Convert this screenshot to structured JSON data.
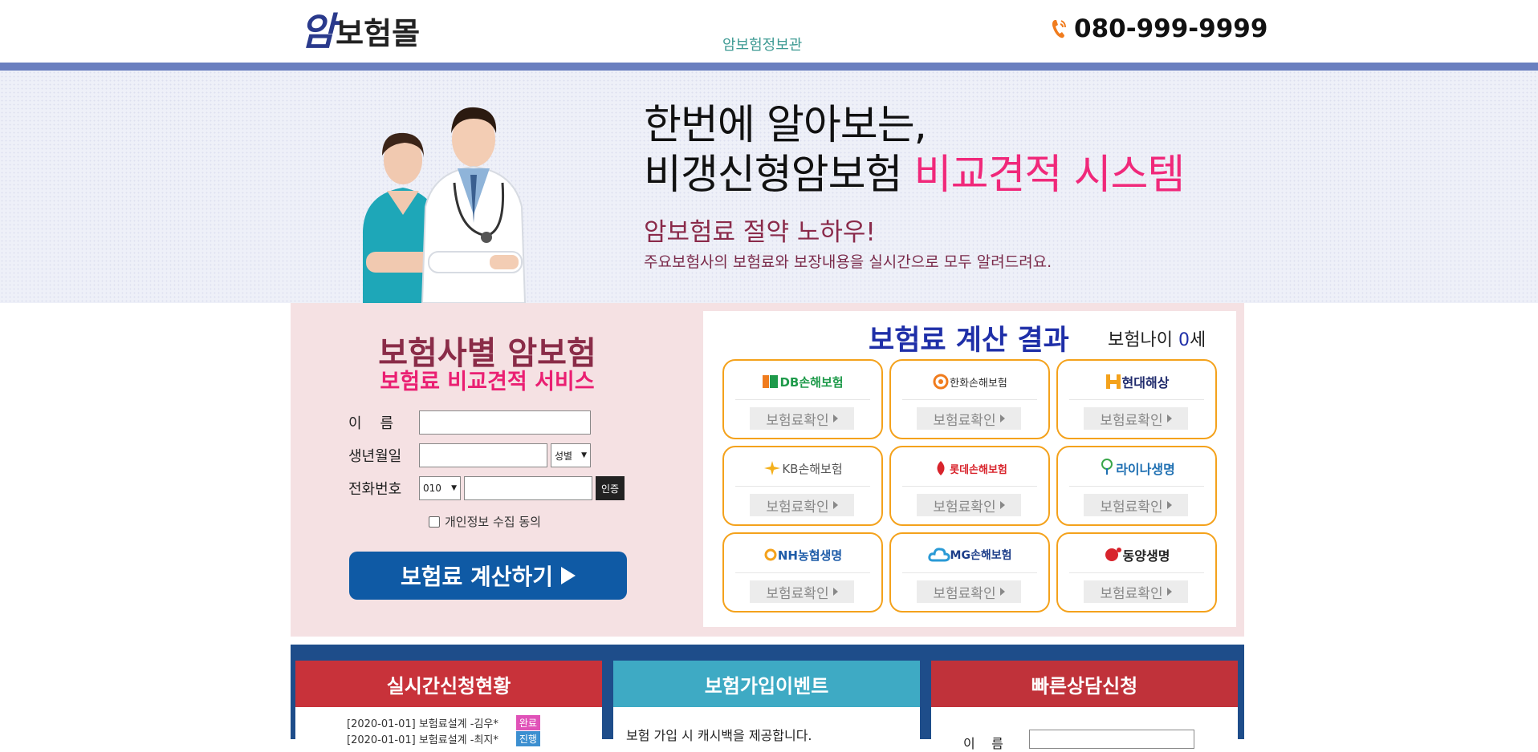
{
  "header": {
    "logo_am": "암",
    "logo_rest": "보험몰",
    "nav_link": "암보험정보관",
    "phone": "080-999-9999"
  },
  "hero": {
    "title_line1": "한번에 알아보는,",
    "title_line2_plain": "비갱신형암보험",
    "title_line2_accent": "비교견적 시스템",
    "subtitle": "암보험료 절약 노하우!",
    "description": "주요보험사의 보험료와 보장내용을 실시간으로 모두 알려드려요."
  },
  "form": {
    "title": "보험사별 암보험",
    "subtitle": "보험료 비교견적 서비스",
    "name_label": "이    름",
    "name_value": "",
    "birth_label": "생년월일",
    "birth_value": "",
    "gender_selected": "성별",
    "phone_label": "전화번호",
    "phone_prefix_selected": "010",
    "phone_value": "",
    "auth_button": "인증",
    "agree_label": "개인정보 수집 동의",
    "submit_label": "보험료 계산하기"
  },
  "results": {
    "title": "보험료 계산 결과",
    "age_prefix": "보험나이",
    "age_value": "0",
    "age_suffix": "세",
    "check_label": "보험료확인",
    "insurers": [
      {
        "name": "DB손해보험",
        "color": "#1e9a4a"
      },
      {
        "name": "한화손해보험",
        "color": "#333333"
      },
      {
        "name": "현대해상",
        "color": "#1f2a6c"
      },
      {
        "name": "KB손해보험",
        "color": "#555555"
      },
      {
        "name": "롯데손해보험",
        "color": "#d8242c"
      },
      {
        "name": "라이나생명",
        "color": "#1e6fb2"
      },
      {
        "name": "NH농협생명",
        "color": "#1e5ca8"
      },
      {
        "name": "MG손해보험",
        "color": "#1e3f8a"
      },
      {
        "name": "동양생명",
        "color": "#222222"
      }
    ]
  },
  "bottom": {
    "panel1": {
      "title": "실시간신청현황",
      "color": "#c8323a",
      "rows": [
        {
          "text": "[2020-01-01] 보험료설계 -김우*",
          "status": "완료",
          "status_color": "#e052b8"
        },
        {
          "text": "[2020-01-01] 보험료설계 -최지*",
          "status": "진행",
          "status_color": "#3c8fd0"
        }
      ]
    },
    "panel2": {
      "title": "보험가입이벤트",
      "color": "#3eaac4",
      "text": "보험 가입 시 캐시백을 제공합니다."
    },
    "panel3": {
      "title": "빠른상담신청",
      "color": "#c0323a",
      "name_label": "이    름"
    }
  }
}
